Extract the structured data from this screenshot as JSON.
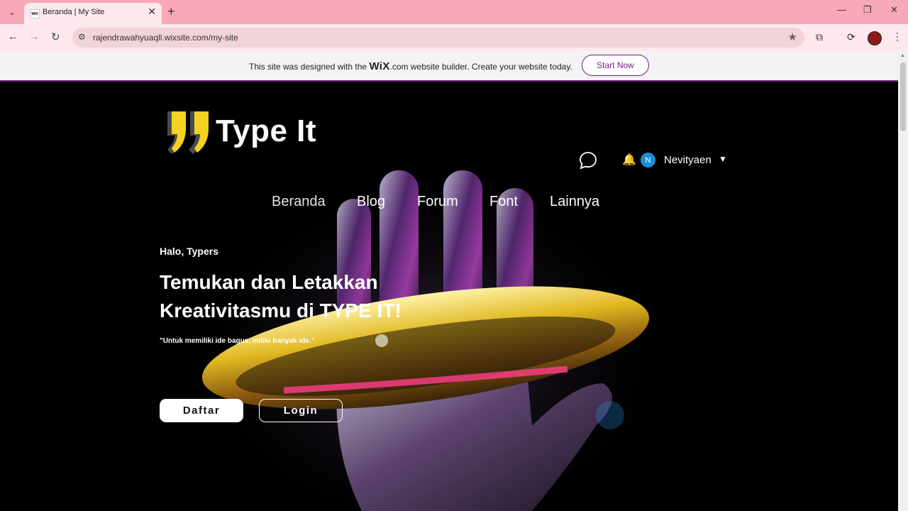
{
  "browser": {
    "tab_title": "Beranda | My Site",
    "url": "rajendrawahyuaqll.wixsite.com/my-site"
  },
  "wix_banner": {
    "text_before": "This site was designed with the",
    "logo": "WiX",
    "text_after": ".com website builder. Create your website today.",
    "button": "Start Now"
  },
  "site": {
    "logo_text": "Type It",
    "user": {
      "initial": "N",
      "name": "Nevityaen"
    },
    "nav": [
      "Beranda",
      "Blog",
      "Forum",
      "Font",
      "Lainnya"
    ],
    "greeting": "Halo, Typers",
    "headline_line1": "Temukan dan Letakkan",
    "headline_line2": "Kreativitasmu di TYPE IT!",
    "quote": "\"Untuk memiliki ide bagus, miliki banyak ide.\"",
    "buttons": {
      "register": "Daftar",
      "login": "Login"
    }
  },
  "colors": {
    "accent": "#6f1f7a",
    "logo_yellow": "#f5d21f",
    "avatar": "#1c8cd8"
  }
}
